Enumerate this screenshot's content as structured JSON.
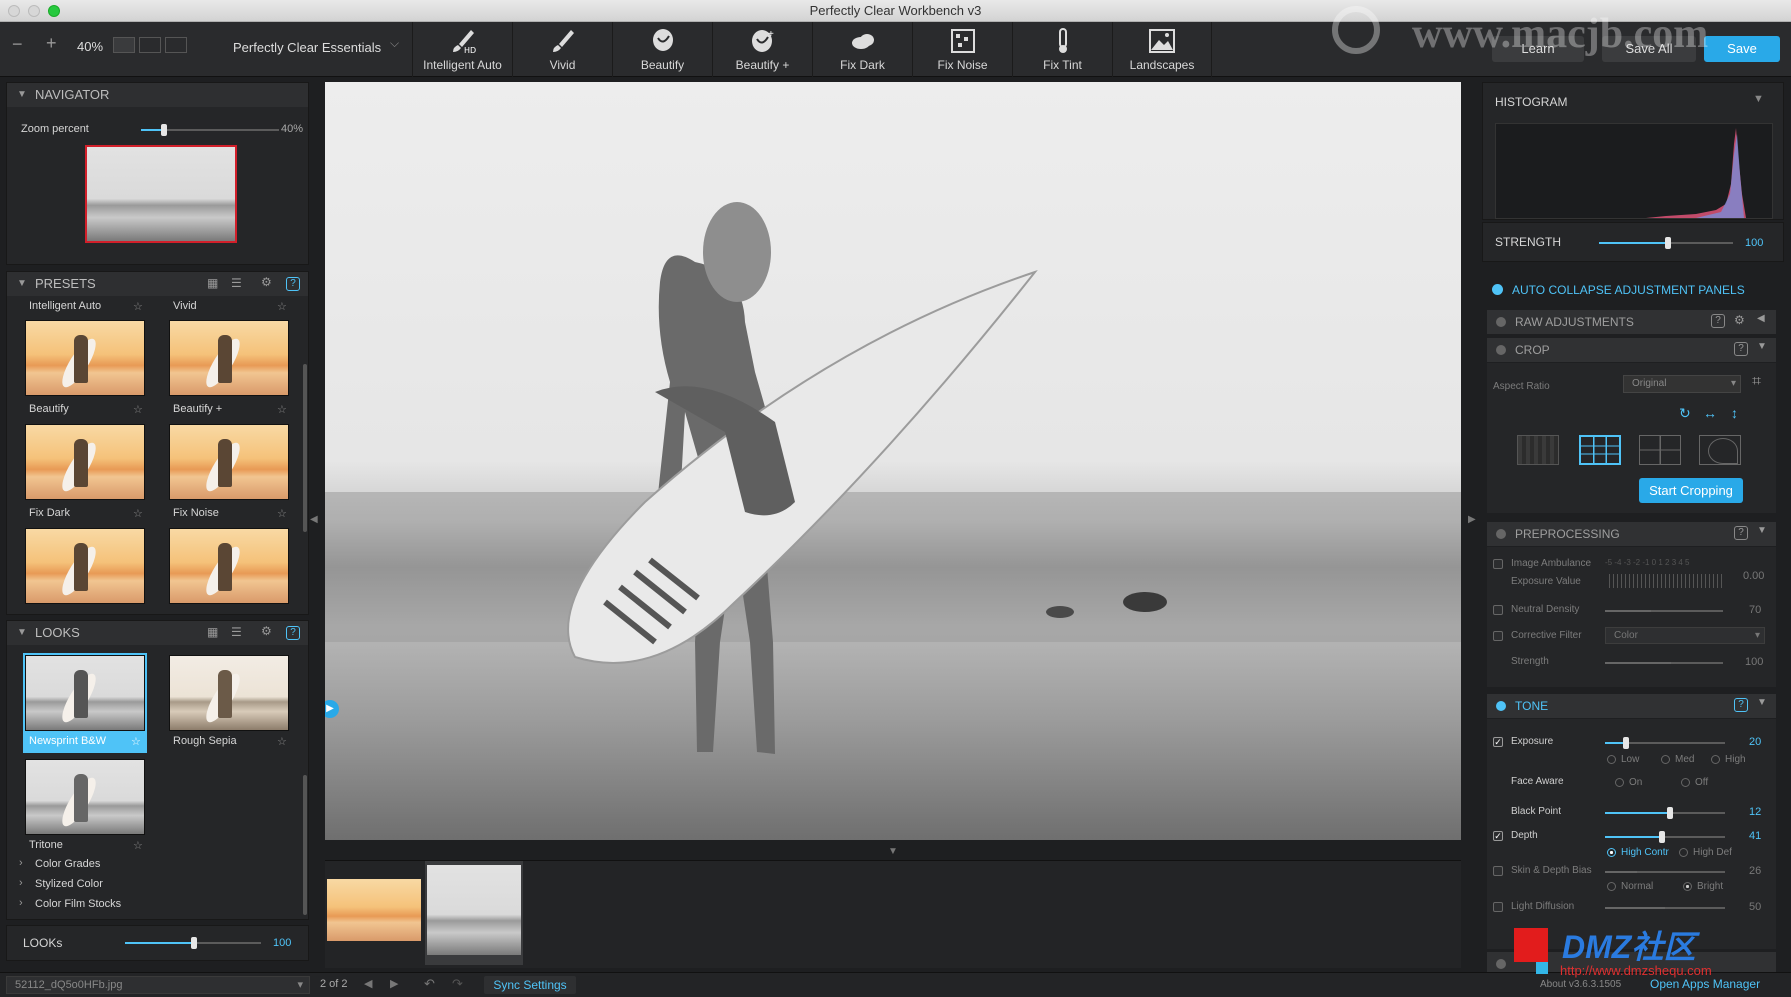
{
  "window": {
    "title": "Perfectly Clear Workbench v3"
  },
  "toolbar": {
    "zoom": "40%",
    "preset_selector": "Perfectly Clear Essentials",
    "buttons": [
      {
        "label": "Intelligent Auto",
        "icon": "brush-hd-icon"
      },
      {
        "label": "Vivid",
        "icon": "brush-icon"
      },
      {
        "label": "Beautify",
        "icon": "face-icon"
      },
      {
        "label": "Beautify +",
        "icon": "face-plus-icon"
      },
      {
        "label": "Fix Dark",
        "icon": "cloud-icon"
      },
      {
        "label": "Fix Noise",
        "icon": "noise-grid-icon"
      },
      {
        "label": "Fix Tint",
        "icon": "thermometer-icon"
      },
      {
        "label": "Landscapes",
        "icon": "landscape-icon"
      }
    ],
    "learn": "Learn",
    "save_all": "Save All",
    "save": "Save"
  },
  "navigator": {
    "title": "NAVIGATOR",
    "zoom_label": "Zoom percent",
    "zoom_value": "40%",
    "zoom_level": 0.4
  },
  "presets": {
    "title": "PRESETS",
    "items": [
      {
        "label": "Intelligent Auto"
      },
      {
        "label": "Vivid"
      },
      {
        "label": "Beautify"
      },
      {
        "label": "Beautify +"
      },
      {
        "label": "Fix Dark"
      },
      {
        "label": "Fix Noise"
      }
    ]
  },
  "looks": {
    "title": "LOOKS",
    "items": [
      {
        "label": "Newsprint B&W",
        "selected": true
      },
      {
        "label": "Rough Sepia"
      },
      {
        "label": "Tritone"
      }
    ],
    "groups": [
      "Color Grades",
      "Stylized Color",
      "Color Film Stocks"
    ],
    "strength_label": "LOOKs",
    "strength_value": "100"
  },
  "histogram": {
    "title": "HISTOGRAM",
    "strength_label": "STRENGTH",
    "strength_value": "100"
  },
  "right_panel": {
    "auto_collapse": "AUTO COLLAPSE ADJUSTMENT PANELS",
    "raw": "RAW ADJUSTMENTS",
    "crop": {
      "title": "CROP",
      "aspect_label": "Aspect Ratio",
      "aspect_value": "Original",
      "start": "Start Cropping"
    },
    "preprocessing": {
      "title": "PREPROCESSING",
      "image_ambulance": "Image Ambulance",
      "exposure_value_label": "Exposure Value",
      "exposure_scale": "-5 -4 -3 -2 -1 0 1 2 3 4 5",
      "exposure_value": "0.00",
      "neutral_density": "Neutral Density",
      "neutral_density_value": "70",
      "corrective_filter": "Corrective Filter",
      "corrective_filter_value": "Color",
      "strength_label": "Strength",
      "strength_value": "100"
    },
    "tone": {
      "title": "TONE",
      "exposure": "Exposure",
      "exposure_value": "20",
      "low": "Low",
      "med": "Med",
      "high": "High",
      "face_aware": "Face Aware",
      "on": "On",
      "off": "Off",
      "black_point": "Black Point",
      "black_point_value": "12",
      "depth": "Depth",
      "depth_value": "41",
      "high_contr": "High Contr",
      "high_def": "High Def",
      "skin_depth_bias": "Skin & Depth Bias",
      "skin_depth_value": "26",
      "normal": "Normal",
      "bright": "Bright",
      "light_diffusion": "Light Diffusion",
      "light_diffusion_value": "50"
    },
    "about": "About v3.6.3.1505",
    "open_apps": "Open Apps Manager"
  },
  "statusbar": {
    "filename": "52112_dQ5o0HFb.jpg",
    "counter": "2 of 2",
    "sync": "Sync Settings"
  },
  "watermarks": {
    "top": "www.macjb.com",
    "bottom_brand": "DMZ社区",
    "bottom_url": "http://www.dmzshequ.com"
  },
  "colors": {
    "accent": "#4fc3f7",
    "background": "#1e1f21"
  }
}
